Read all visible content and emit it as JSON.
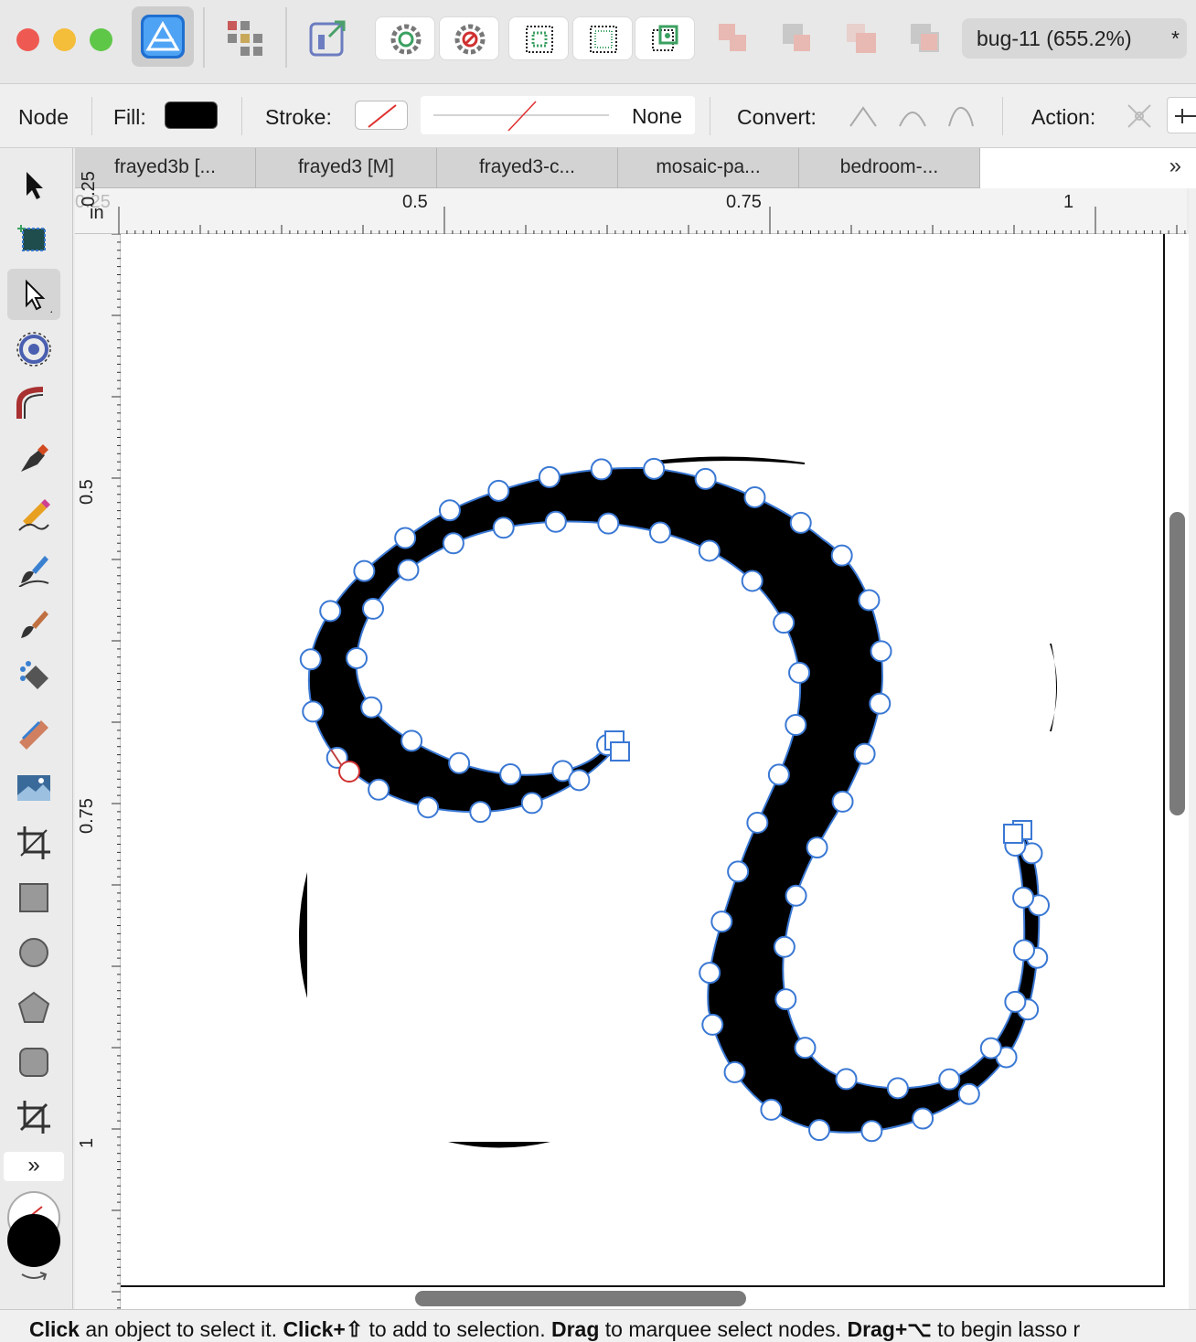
{
  "window": {
    "document_title": "bug-11 (655.2%)",
    "modified_mark": "*"
  },
  "context_toolbar": {
    "tool_name": "Node",
    "fill_label": "Fill:",
    "fill_color": "#000000",
    "stroke_label": "Stroke:",
    "stroke_style_value": "None",
    "convert_label": "Convert:",
    "action_label": "Action:"
  },
  "tabs": [
    {
      "label": "frayed3b [..."
    },
    {
      "label": "frayed3 [M]"
    },
    {
      "label": "frayed3-c..."
    },
    {
      "label": "mosaic-pa..."
    },
    {
      "label": "bedroom-..."
    },
    {
      "label": ""
    }
  ],
  "tabs_overflow": "»",
  "rulers": {
    "top": {
      "unit": "in",
      "labels": [
        "0.25",
        "0.5",
        "0.75",
        "1"
      ]
    },
    "left": {
      "labels": [
        "0.25",
        "0.5",
        "0.75",
        "1"
      ]
    }
  },
  "tools": [
    "move-tool-icon",
    "artboard-tool-icon",
    "node-tool-icon",
    "contour-tool-icon",
    "corner-tool-icon",
    "pen-tool-icon",
    "pencil-tool-icon",
    "vector-brush-icon",
    "pixel-brush-icon",
    "fill-tool-icon",
    "transparency-tool-icon",
    "place-image-icon",
    "crop-tool-icon",
    "rectangle-tool-icon",
    "ellipse-tool-icon",
    "polygon-tool-icon",
    "rounded-rect-tool-icon",
    "slice-tool-icon"
  ],
  "toolbox_more": "»",
  "colors": {
    "fill_swatch": "#000000",
    "accent": "#3a78d4",
    "selected_node": "#d03030"
  },
  "status": {
    "p1_bold": "Click",
    "p1": " an object to select it. ",
    "p2_bold": "Click+⇧",
    "p2": " to add to selection. ",
    "p3_bold": "Drag",
    "p3": " to marquee select nodes. ",
    "p4_bold": "Drag+⌥",
    "p4": " to begin lasso r"
  }
}
